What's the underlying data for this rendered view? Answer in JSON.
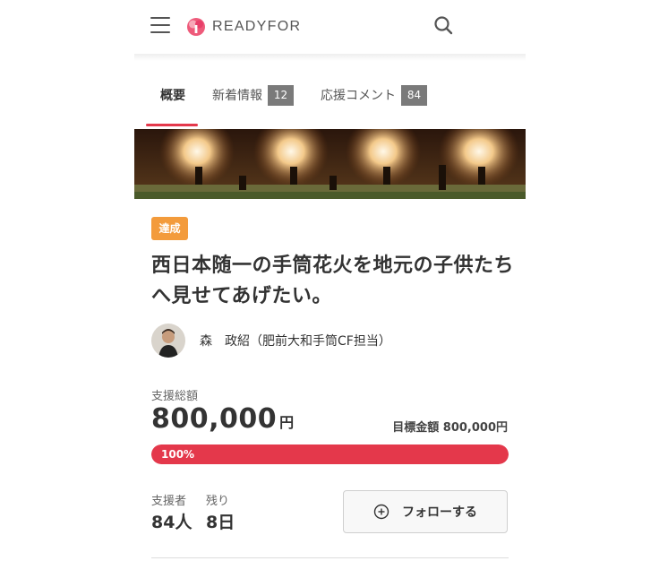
{
  "header": {
    "logo_text": "READYFOR",
    "menu_icon": "hamburger-menu-icon",
    "search_icon": "search-icon"
  },
  "tabs": [
    {
      "label": "概要",
      "active": true
    },
    {
      "label": "新着情報",
      "count": "12"
    },
    {
      "label": "応援コメント",
      "count": "84"
    }
  ],
  "project": {
    "status_badge": "達成",
    "title": "西日本随一の手筒花火を地元の子供たちへ見せてあげたい。",
    "owner_name": "森　政紹（肥前大和手筒CF担当）"
  },
  "funding": {
    "raised_label": "支援総額",
    "raised_amount": "800,000",
    "raised_unit": "円",
    "target_text": "目標金額 800,000円",
    "progress_percent": 100,
    "progress_text": "100%"
  },
  "stats": {
    "supporters_label": "支援者",
    "supporters_value": "84人",
    "remaining_label": "残り",
    "remaining_value": "8日"
  },
  "follow_button": {
    "label": "フォローする",
    "icon": "plus-circle-icon"
  },
  "colors": {
    "accent": "#e4384b",
    "badge": "#f39b3c",
    "tab_count": "#7a7a7a"
  }
}
